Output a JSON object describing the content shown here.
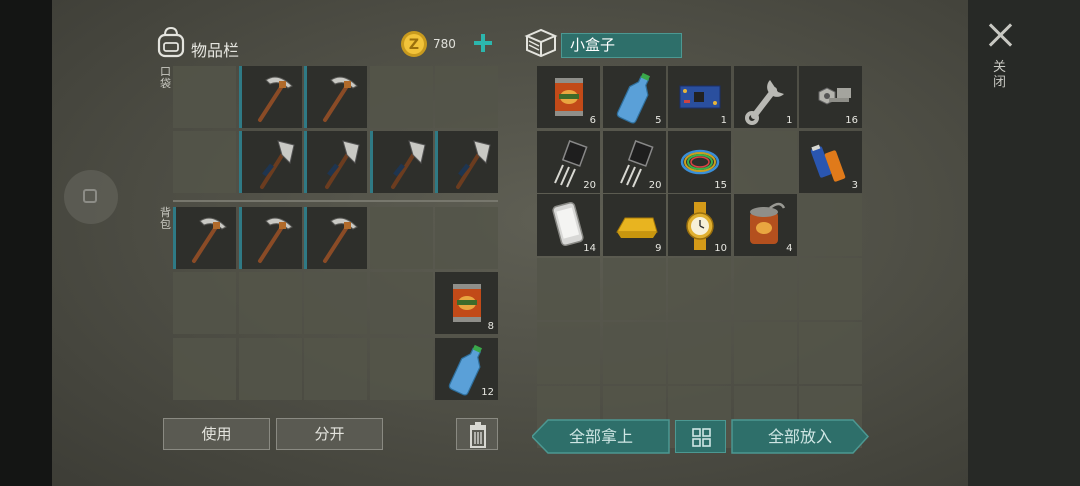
{
  "inventory": {
    "title": "物品栏",
    "coins": "780",
    "pocket_label": "口袋",
    "backpack_label": "背包"
  },
  "container": {
    "name": "小盒子"
  },
  "buttons": {
    "use": "使用",
    "split": "分开",
    "take_all": "全部拿上",
    "put_all": "全部放入"
  },
  "close_label": "关闭",
  "colors": {
    "accent": "#2cb6ad",
    "selected_fill": "#2e6f6a",
    "slot_filled": "#2e2f2b",
    "slot_empty": "#545549"
  },
  "inventory_slots": [
    {
      "item": "empty",
      "count": ""
    },
    {
      "item": "pickaxe",
      "count": ""
    },
    {
      "item": "pickaxe",
      "count": ""
    },
    {
      "item": "empty",
      "count": ""
    },
    {
      "item": "empty",
      "count": ""
    },
    {
      "item": "empty",
      "count": ""
    },
    {
      "item": "axe",
      "count": ""
    },
    {
      "item": "axe",
      "count": ""
    },
    {
      "item": "axe",
      "count": ""
    },
    {
      "item": "axe",
      "count": ""
    },
    {
      "item": "pickaxe",
      "count": ""
    },
    {
      "item": "pickaxe",
      "count": ""
    },
    {
      "item": "pickaxe",
      "count": ""
    },
    {
      "item": "empty",
      "count": ""
    },
    {
      "item": "empty",
      "count": ""
    },
    {
      "item": "empty",
      "count": ""
    },
    {
      "item": "empty",
      "count": ""
    },
    {
      "item": "empty",
      "count": ""
    },
    {
      "item": "empty",
      "count": ""
    },
    {
      "item": "food-can",
      "count": "8"
    },
    {
      "item": "empty",
      "count": ""
    },
    {
      "item": "empty",
      "count": ""
    },
    {
      "item": "empty",
      "count": ""
    },
    {
      "item": "empty",
      "count": ""
    },
    {
      "item": "water-bottle",
      "count": "12"
    }
  ],
  "container_slots": [
    {
      "item": "food-can",
      "count": "6"
    },
    {
      "item": "water-bottle",
      "count": "5"
    },
    {
      "item": "circuit-board",
      "count": "1"
    },
    {
      "item": "wrench",
      "count": "1"
    },
    {
      "item": "nuts-bolts",
      "count": "16"
    },
    {
      "item": "transistor",
      "count": "20"
    },
    {
      "item": "transistor",
      "count": "20"
    },
    {
      "item": "wires",
      "count": "15"
    },
    {
      "item": "empty",
      "count": ""
    },
    {
      "item": "batteries",
      "count": "3"
    },
    {
      "item": "smartphone",
      "count": "14"
    },
    {
      "item": "gold-bar",
      "count": "9"
    },
    {
      "item": "gold-watch",
      "count": "10"
    },
    {
      "item": "open-can",
      "count": "4"
    },
    {
      "item": "empty",
      "count": ""
    },
    {
      "item": "empty",
      "count": ""
    },
    {
      "item": "empty",
      "count": ""
    },
    {
      "item": "empty",
      "count": ""
    },
    {
      "item": "empty",
      "count": ""
    },
    {
      "item": "empty",
      "count": ""
    },
    {
      "item": "empty",
      "count": ""
    },
    {
      "item": "empty",
      "count": ""
    },
    {
      "item": "empty",
      "count": ""
    },
    {
      "item": "empty",
      "count": ""
    },
    {
      "item": "empty",
      "count": ""
    },
    {
      "item": "empty",
      "count": ""
    },
    {
      "item": "empty",
      "count": ""
    },
    {
      "item": "empty",
      "count": ""
    },
    {
      "item": "empty",
      "count": ""
    },
    {
      "item": "empty",
      "count": ""
    }
  ]
}
